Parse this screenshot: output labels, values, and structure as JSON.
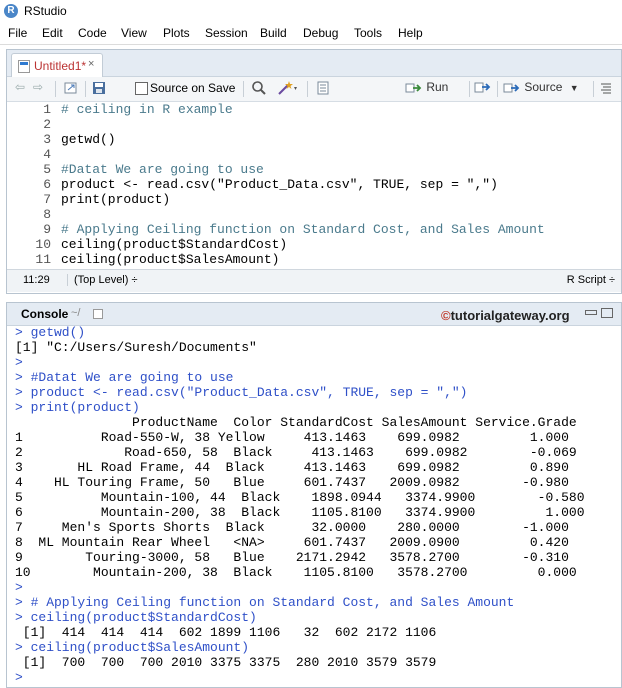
{
  "window": {
    "title": "RStudio",
    "logo": "R"
  },
  "menu": [
    "File",
    "Edit",
    "Code",
    "View",
    "Plots",
    "Session",
    "Build",
    "Debug",
    "Tools",
    "Help"
  ],
  "editor": {
    "tab_label": "Untitled1*",
    "tab_close": "×",
    "toolbar": {
      "source_on_save": "Source on Save",
      "run": "Run",
      "source": "Source"
    },
    "lines": [
      {
        "n": "1",
        "text": "# ceiling in R example"
      },
      {
        "n": "2",
        "text": ""
      },
      {
        "n": "3",
        "text": "getwd()"
      },
      {
        "n": "4",
        "text": ""
      },
      {
        "n": "5",
        "text": "#Datat We are going to use"
      },
      {
        "n": "6",
        "text": "product <- read.csv(\"Product_Data.csv\", TRUE, sep = \",\")"
      },
      {
        "n": "7",
        "text": "print(product)"
      },
      {
        "n": "8",
        "text": ""
      },
      {
        "n": "9",
        "text": "# Applying Ceiling function on Standard Cost, and Sales Amount"
      },
      {
        "n": "10",
        "text": "ceiling(product$StandardCost)"
      },
      {
        "n": "11",
        "text": "ceiling(product$SalesAmount)"
      }
    ],
    "status": {
      "position": "11:29",
      "scope": "(Top Level) ÷",
      "file_type": "R Script ÷"
    }
  },
  "console": {
    "title": "Console",
    "path": "~/",
    "watermark_c": "©",
    "watermark": "tutorialgateway.org",
    "lines": [
      "> getwd()",
      "[1] \"C:/Users/Suresh/Documents\"",
      ">",
      "> #Datat We are going to use",
      "> product <- read.csv(\"Product_Data.csv\", TRUE, sep = \",\")",
      "> print(product)",
      "               ProductName  Color StandardCost SalesAmount Service.Grade",
      "1          Road-550-W, 38 Yellow     413.1463    699.0982         1.000",
      "2             Road-650, 58  Black     413.1463    699.0982        -0.069",
      "3       HL Road Frame, 44  Black     413.1463    699.0982         0.890",
      "4    HL Touring Frame, 50   Blue     601.7437   2009.0982        -0.980",
      "5          Mountain-100, 44  Black    1898.0944   3374.9900        -0.580",
      "6          Mountain-200, 38  Black    1105.8100   3374.9900         1.000",
      "7     Men's Sports Shorts  Black      32.0000    280.0000        -1.000",
      "8  ML Mountain Rear Wheel   <NA>     601.7437   2009.0900         0.420",
      "9        Touring-3000, 58   Blue    2171.2942   3578.2700        -0.310",
      "10        Mountain-200, 38  Black    1105.8100   3578.2700         0.000",
      ">",
      "> # Applying Ceiling function on Standard Cost, and Sales Amount",
      "> ceiling(product$StandardCost)",
      " [1]  414  414  414  602 1899 1106   32  602 2172 1106",
      "> ceiling(product$SalesAmount)",
      " [1]  700  700  700 2010 3375 3375  280 2010 3579 3579",
      ">"
    ]
  }
}
